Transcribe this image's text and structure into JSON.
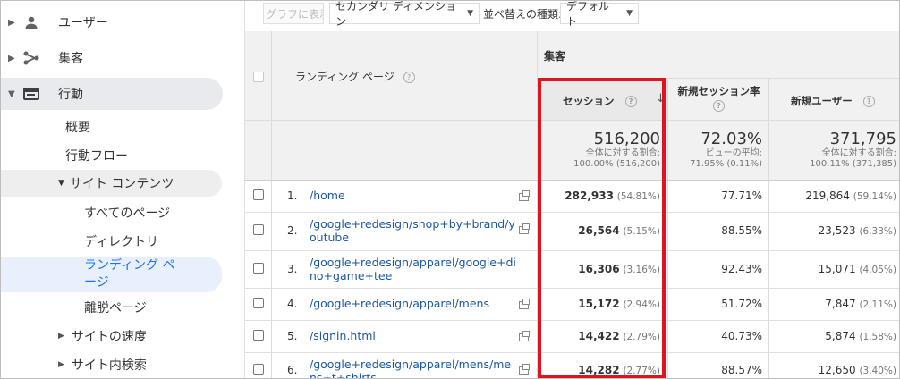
{
  "sidebar": {
    "items": [
      {
        "label": "ユーザー",
        "icon": "person-icon"
      },
      {
        "label": "集客",
        "icon": "acquisition-icon"
      },
      {
        "label": "行動",
        "icon": "behavior-icon"
      }
    ],
    "behavior_sub": [
      {
        "label": "概要"
      },
      {
        "label": "行動フロー"
      },
      {
        "label": "サイト コンテンツ"
      },
      {
        "label": "すべてのページ"
      },
      {
        "label": "ディレクトリ"
      },
      {
        "label": "ランディング ページ"
      },
      {
        "label": "離脱ページ"
      },
      {
        "label": "サイトの速度"
      },
      {
        "label": "サイト内検索"
      }
    ]
  },
  "toolbar": {
    "graph_button": "グラフに表示",
    "secondary_dimension": "セカンダリ ディメンション",
    "sort_label": "並べ替えの種類:",
    "sort_value": "デフォルト"
  },
  "table": {
    "header": {
      "landing_page": "ランディング ページ",
      "group": "集客",
      "sessions": "セッション",
      "new_session_rate": "新規セッション率",
      "new_users": "新規ユーザー"
    },
    "totals": {
      "sessions": {
        "value": "516,200",
        "line1": "全体に対する割合:",
        "line2": "100.00% (516,200)"
      },
      "new_session_rate": {
        "value": "72.03%",
        "line1": "ビューの平均:",
        "line2": "71.95% (0.11%)"
      },
      "new_users": {
        "value": "371,795",
        "line1": "全体に対する割合:",
        "line2": "100.11% (371,385)"
      }
    },
    "rows": [
      {
        "idx": "1.",
        "page": "/home",
        "sessions": "282,933",
        "sessions_pct": "(54.81%)",
        "rate": "77.71%",
        "users": "219,864",
        "users_pct": "(59.14%)"
      },
      {
        "idx": "2.",
        "page": "/google+redesign/shop+by+brand/youtube",
        "sessions": "26,564",
        "sessions_pct": "(5.15%)",
        "rate": "88.55%",
        "users": "23,523",
        "users_pct": "(6.33%)"
      },
      {
        "idx": "3.",
        "page": "/google+redesign/apparel/google+dino+game+tee",
        "sessions": "16,306",
        "sessions_pct": "(3.16%)",
        "rate": "92.43%",
        "users": "15,071",
        "users_pct": "(4.05%)"
      },
      {
        "idx": "4.",
        "page": "/google+redesign/apparel/mens",
        "sessions": "15,172",
        "sessions_pct": "(2.94%)",
        "rate": "51.72%",
        "users": "7,847",
        "users_pct": "(2.11%)"
      },
      {
        "idx": "5.",
        "page": "/signin.html",
        "sessions": "14,422",
        "sessions_pct": "(2.79%)",
        "rate": "40.73%",
        "users": "5,874",
        "users_pct": "(1.58%)"
      },
      {
        "idx": "6.",
        "page": "/google+redesign/apparel/mens/mens+t+shirts",
        "sessions": "14,282",
        "sessions_pct": "(2.77%)",
        "rate": "88.57%",
        "users": "12,650",
        "users_pct": "(3.40%)"
      }
    ]
  },
  "colors": {
    "highlight_box": "#e0141e",
    "link": "#1a58a5",
    "selected_nav": "#e8f0fe"
  }
}
